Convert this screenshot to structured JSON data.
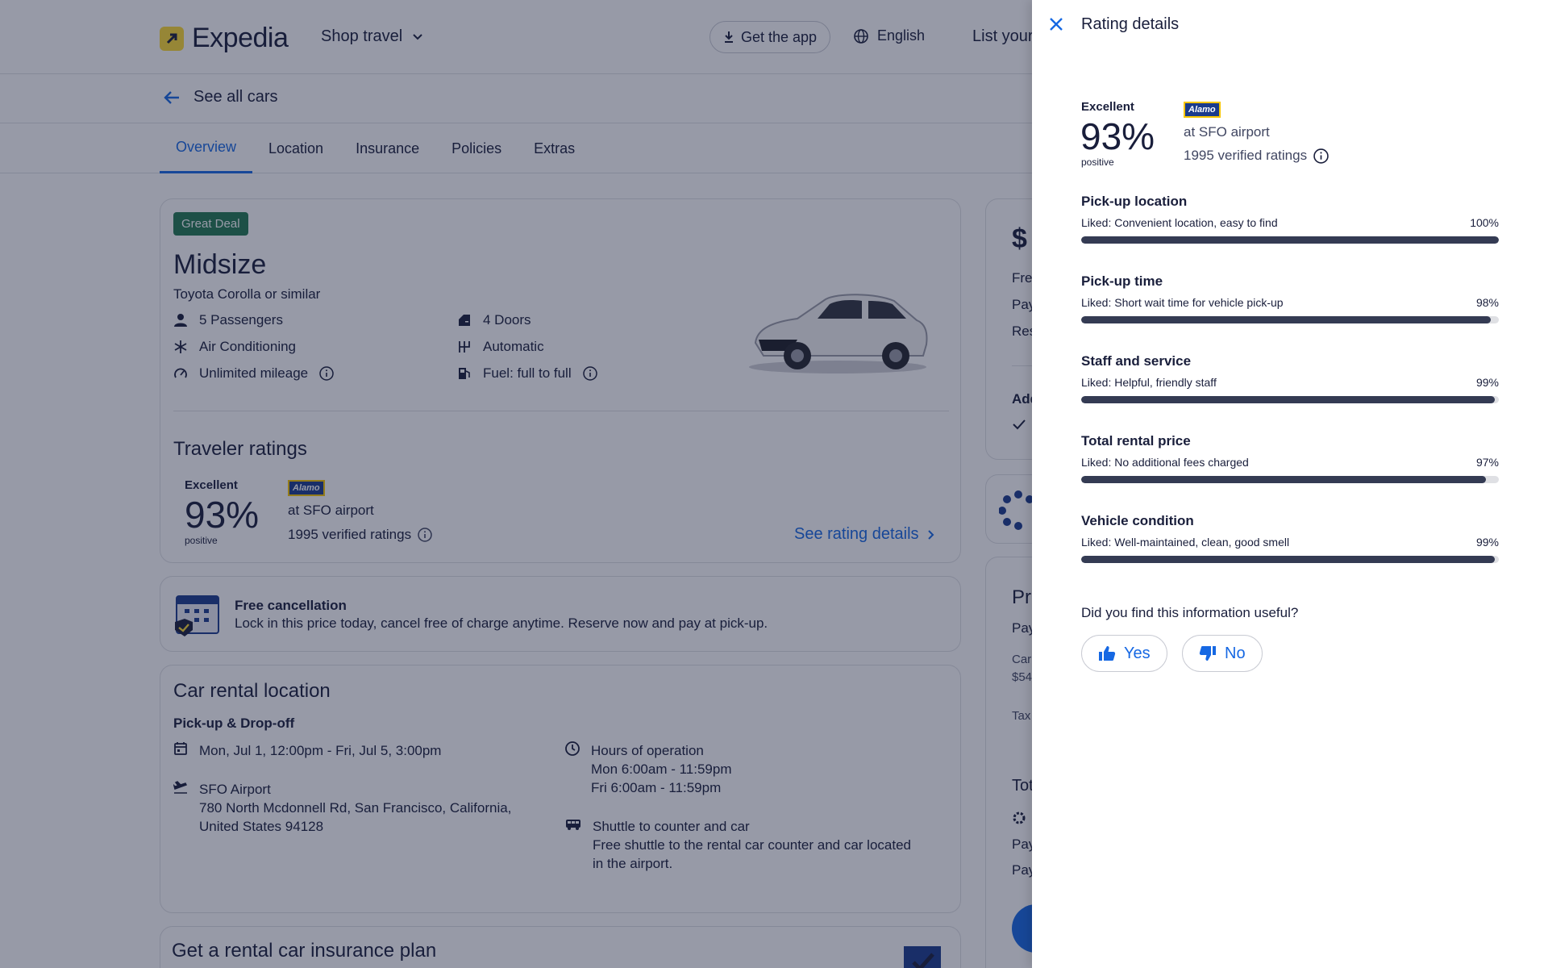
{
  "header": {
    "brand": "Expedia",
    "shop_travel": "Shop travel",
    "get_app": "Get the app",
    "language": "English",
    "list_property": "List your property"
  },
  "back": {
    "label": "See all cars"
  },
  "tabs": [
    {
      "label": "Overview",
      "active": true
    },
    {
      "label": "Location",
      "active": false
    },
    {
      "label": "Insurance",
      "active": false
    },
    {
      "label": "Policies",
      "active": false
    },
    {
      "label": "Extras",
      "active": false
    }
  ],
  "car": {
    "badge": "Great Deal",
    "title": "Midsize",
    "subtitle": "Toyota Corolla or similar",
    "features": {
      "passengers": "5 Passengers",
      "ac": "Air Conditioning",
      "mileage": "Unlimited mileage",
      "doors": "4 Doors",
      "transmission": "Automatic",
      "fuel": "Fuel: full to full"
    }
  },
  "traveler_ratings": {
    "title": "Traveler ratings",
    "label": "Excellent",
    "score": "93%",
    "score_sub": "positive",
    "vendor": "Alamo",
    "location": "at SFO airport",
    "verified": "1995 verified ratings",
    "see_details": "See rating details"
  },
  "free_cancel": {
    "title": "Free cancellation",
    "text": "Lock in this price today, cancel free of charge anytime. Reserve now and pay at pick-up."
  },
  "location_card": {
    "title": "Car rental location",
    "subtitle": "Pick-up & Drop-off",
    "dates": "Mon, Jul 1, 12:00pm - Fri, Jul 5, 3:00pm",
    "airport": "SFO Airport",
    "address1": "780 North Mcdonnell Rd, San Francisco, California,",
    "address2": "United States 94128",
    "hours_title": "Hours of operation",
    "hours1": "Mon 6:00am - 11:59pm",
    "hours2": "Fri 6:00am - 11:59pm",
    "shuttle_title": "Shuttle to counter and car",
    "shuttle1": "Free shuttle to the rental car counter and car located",
    "shuttle2": "in the airport."
  },
  "insurance": {
    "title": "Get a rental car insurance plan"
  },
  "right_col": {
    "price": "$",
    "t1": "Fre",
    "t2": "Pay",
    "t3": "Res",
    "t4": "Add",
    "t5": "Pr",
    "t6": "Pay",
    "t7": "Car",
    "t8": "$54",
    "t9": "Tax",
    "t10": "Tot",
    "t11": "Pay",
    "t12": "Pay"
  },
  "sheet": {
    "title": "Rating details",
    "label": "Excellent",
    "score": "93%",
    "score_sub": "positive",
    "vendor": "Alamo",
    "location": "at SFO airport",
    "verified": "1995 verified ratings",
    "categories": [
      {
        "title": "Pick-up location",
        "liked": "Liked: Convenient location, easy to find",
        "pct": "100%",
        "value": 100
      },
      {
        "title": "Pick-up time",
        "liked": "Liked: Short wait time for vehicle pick-up",
        "pct": "98%",
        "value": 98
      },
      {
        "title": "Staff and service",
        "liked": "Liked: Helpful, friendly staff",
        "pct": "99%",
        "value": 99
      },
      {
        "title": "Total rental price",
        "liked": "Liked: No additional fees charged",
        "pct": "97%",
        "value": 97
      },
      {
        "title": "Vehicle condition",
        "liked": "Liked: Well-maintained, clean, good smell",
        "pct": "99%",
        "value": 99
      }
    ],
    "useful_q": "Did you find this information useful?",
    "yes": "Yes",
    "no": "No"
  },
  "colors": {
    "accent": "#1668e3",
    "navy": "#191e3b",
    "bar": "#343b53",
    "deal": "#227950"
  }
}
